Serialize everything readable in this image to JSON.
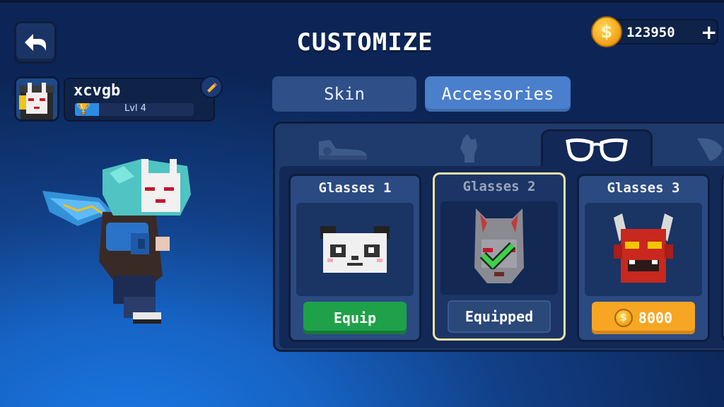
{
  "header": {
    "title": "CUSTOMIZE",
    "coins": "123950",
    "add_label": "+"
  },
  "profile": {
    "username": "xcvgb",
    "level": "Lvl 4",
    "level_progress": 0.2
  },
  "tabs": [
    {
      "label": "Skin",
      "active": false
    },
    {
      "label": "Accessories",
      "active": true
    }
  ],
  "categories": [
    {
      "icon": "shoe-icon",
      "active": false
    },
    {
      "icon": "hand-icon",
      "active": false
    },
    {
      "icon": "glasses-icon",
      "active": true
    },
    {
      "icon": "wing-icon",
      "active": false
    }
  ],
  "items": [
    {
      "name": "Glasses 1",
      "icon": "panda-mask-icon",
      "button": "Equip",
      "state": "equip"
    },
    {
      "name": "Glasses 2",
      "icon": "fox-mask-icon",
      "button": "Equipped",
      "state": "equipped"
    },
    {
      "name": "Glasses 3",
      "icon": "oni-mask-icon",
      "button": "8000",
      "state": "price"
    }
  ],
  "colors": {
    "equip_green": "#1fa14a",
    "price_orange": "#f6a623",
    "selected_border": "#f3e3a2",
    "active_tab": "#4a7fcc"
  }
}
